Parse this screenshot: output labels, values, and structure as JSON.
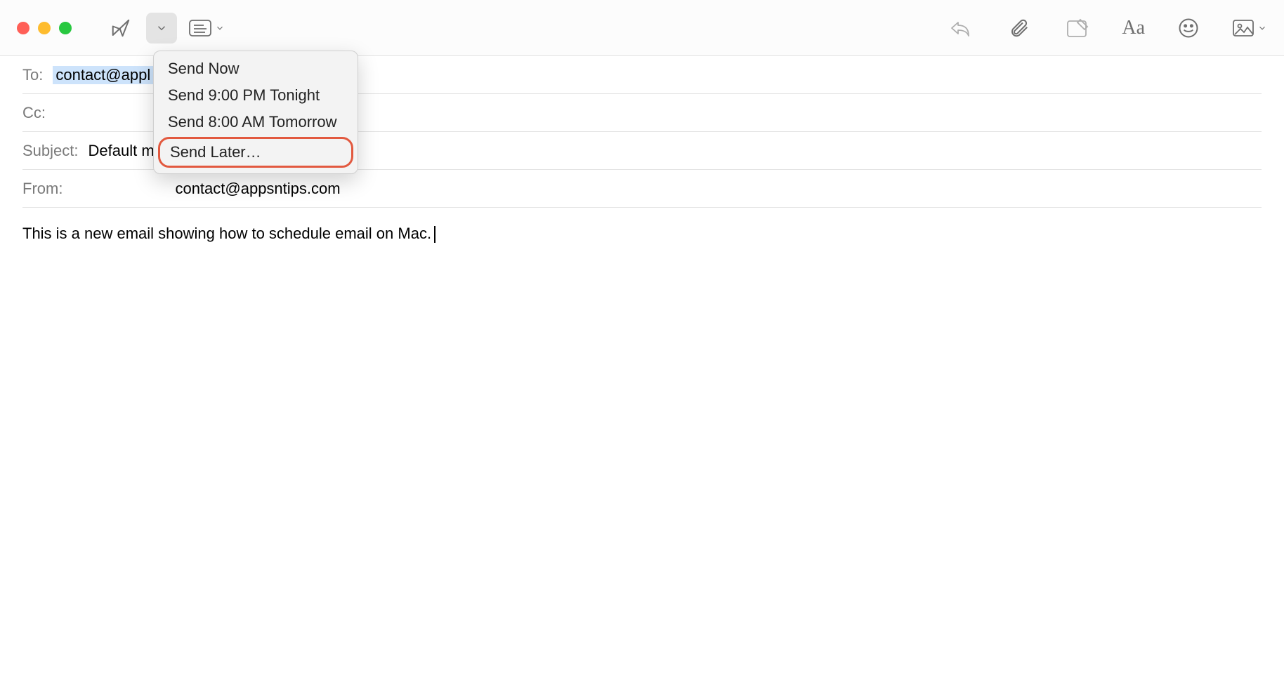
{
  "toolbar": {
    "icons": {
      "send": "send-icon",
      "send_dropdown": "chevron-down-icon",
      "header_fields": "header-fields-icon",
      "reply": "reply-icon",
      "attach": "paperclip-icon",
      "markup": "markup-icon",
      "format": "format-icon",
      "emoji": "emoji-icon",
      "photo": "photo-icon"
    },
    "format_label": "Aa"
  },
  "dropdown": {
    "items": [
      "Send Now",
      "Send 9:00 PM Tonight",
      "Send 8:00 AM Tomorrow",
      "Send Later…"
    ],
    "highlighted_index": 3
  },
  "fields": {
    "to_label": "To:",
    "to_value": "contact@appl",
    "cc_label": "Cc:",
    "subject_label": "Subject:",
    "subject_value": "Default m",
    "from_label": "From:",
    "from_value": "contact@appsntips.com"
  },
  "body_text": "This is a new email showing how to schedule email on Mac."
}
